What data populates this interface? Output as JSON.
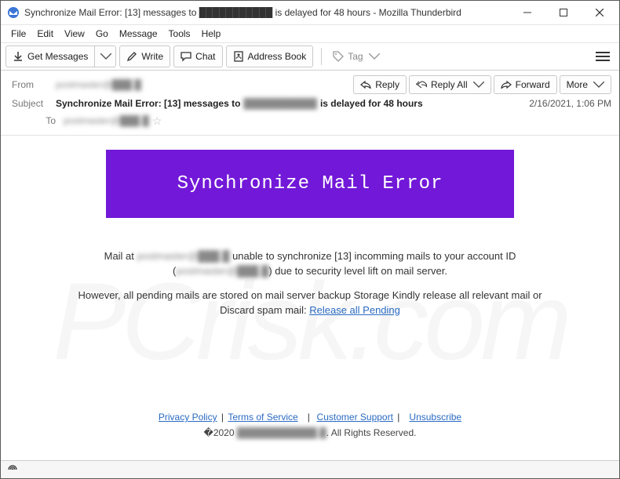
{
  "window": {
    "title": "Synchronize Mail Error: [13] messages to ███████████ is delayed for 48 hours - Mozilla Thunderbird"
  },
  "menubar": [
    "File",
    "Edit",
    "View",
    "Go",
    "Message",
    "Tools",
    "Help"
  ],
  "toolbar": {
    "get_messages": "Get Messages",
    "write": "Write",
    "chat": "Chat",
    "address_book": "Address Book",
    "tag": "Tag"
  },
  "header": {
    "labels": {
      "from": "From",
      "subject": "Subject",
      "to": "To"
    },
    "from_redacted": "postmaster@███.█",
    "subject_prefix": "Synchronize Mail Error: [13] messages to ",
    "subject_redacted": "███████████",
    "subject_suffix": " is delayed for 48 hours",
    "to_redacted": "postmaster@███.█",
    "actions": {
      "reply": "Reply",
      "reply_all": "Reply All",
      "forward": "Forward",
      "more": "More"
    },
    "date": "2/16/2021, 1:06 PM"
  },
  "email": {
    "banner": "Synchronize Mail Error",
    "p1a": "Mail at ",
    "p1_redacted1": "postmaster@███.█",
    "p1b": " unable to synchronize [13] incomming mails to your account ID (",
    "p1_redacted2": "postmaster@███.█",
    "p1c": ") due to security level lift on mail server.",
    "p2": "However, all pending mails are stored on mail server backup Storage Kindly release all relevant mail or Discard spam mail:  ",
    "release_link": "Release all Pending",
    "footer_links": {
      "privacy": "Privacy Policy",
      "terms": "Terms of Service",
      "support": "Customer Support",
      "unsubscribe": "Unsubscribe"
    },
    "footer_sep": " | ",
    "copyright_a": "�2020 ",
    "copyright_redacted": "████████████.█",
    "copyright_b": ". All Rights Reserved."
  },
  "watermark": "PCrisk.com"
}
